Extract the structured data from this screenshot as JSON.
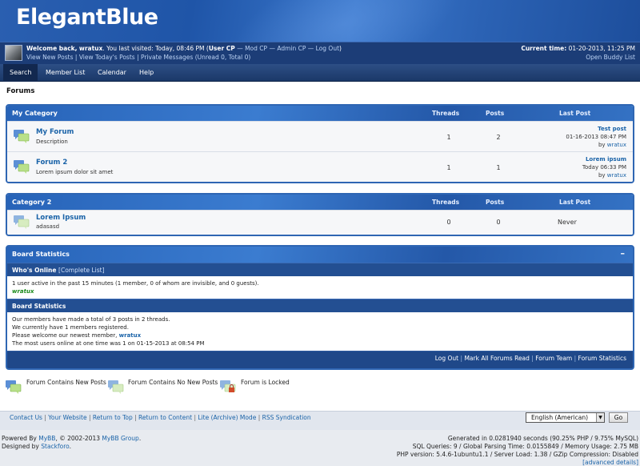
{
  "header": {
    "logo": "ElegantBlue"
  },
  "panel": {
    "welcome_prefix": "Welcome back,",
    "username": "wratux",
    "last_visit": ". You last visited: Today, 08:46 PM (",
    "user_cp": "User CP",
    "mod_cp": "Mod CP",
    "admin_cp": "Admin CP",
    "logout": "Log Out",
    "close": ")",
    "dash": "—",
    "view_new_posts": "View New Posts",
    "view_todays_posts": "View Today's Posts",
    "private_messages": "Private Messages",
    "pm_count": "(Unread 0, Total 0)",
    "current_time_label": "Current time:",
    "current_time": "01-20-2013, 11:25 PM",
    "open_buddy_list": "Open Buddy List",
    "sep": "|"
  },
  "nav": {
    "tabs": [
      "Search",
      "Member List",
      "Calendar",
      "Help"
    ]
  },
  "breadcrumb": "Forums",
  "columns": {
    "threads": "Threads",
    "posts": "Posts",
    "last_post": "Last Post"
  },
  "categories": [
    {
      "name": "My Category",
      "forums": [
        {
          "name": "My Forum",
          "description": "Description",
          "threads": "1",
          "posts": "2",
          "last_post": {
            "title": "Test post",
            "date": "01-16-2013 08:47 PM",
            "by": "by",
            "author": "wratux"
          }
        },
        {
          "name": "Forum 2",
          "description": "Lorem ipsum dolor sit amet",
          "threads": "1",
          "posts": "1",
          "last_post": {
            "title": "Lorem ipsum",
            "date": "Today 06:33 PM",
            "by": "by",
            "author": "wratux"
          }
        }
      ]
    },
    {
      "name": "Category 2",
      "forums": [
        {
          "name": "Lorem Ipsum",
          "description": "adasasd",
          "threads": "0",
          "posts": "0",
          "last_post": {
            "never": "Never"
          }
        }
      ]
    }
  ],
  "board_stats": {
    "title": "Board Statistics",
    "collapse": "–",
    "whos_online": "Who's Online",
    "complete_list": "[Complete List]",
    "online_text": "1 user active in the past 15 minutes (1 member, 0 of whom are invisible, and 0 guests).",
    "online_user": "wratux",
    "stats_title": "Board Statistics",
    "stats_line1": "Our members have made a total of 3 posts in 2 threads.",
    "stats_line2": "We currently have 1 members registered.",
    "stats_line3_prefix": "Please welcome our newest member,",
    "newest_member": "wratux",
    "stats_line4": "The most users online at one time was 1 on 01-15-2013 at 08:54 PM",
    "footer_links": [
      "Log Out",
      "Mark All Forums Read",
      "Forum Team",
      "Forum Statistics"
    ]
  },
  "legend": {
    "new_posts": "Forum Contains New Posts",
    "no_new_posts": "Forum Contains No New Posts",
    "locked": "Forum is Locked"
  },
  "footer": {
    "links": [
      "Contact Us",
      "Your Website",
      "Return to Top",
      "Return to Content",
      "Lite (Archive) Mode",
      "RSS Syndication"
    ],
    "language": "English (American)",
    "go": "Go"
  },
  "copyright": {
    "powered_by": "Powered By",
    "mybb": "MyBB",
    "years": ", © 2002-2013",
    "mybb_group": "MyBB Group",
    "designed_by": "Designed by",
    "stackforo": "Stackforo",
    "generated": "Generated in 0.0281940 seconds (90.25% PHP / 9.75% MySQL)",
    "queries": "SQL Queries: 9 / Global Parsing Time: 0.0155849 / Memory Usage: 2.75 MB",
    "php": "PHP version: 5.4.6-1ubuntu1.1 / Server Load: 1.38 / GZip Compression: Disabled",
    "advanced": "[advanced details]"
  },
  "colors": {
    "accent": "#2f66b3",
    "header": "#2a5fb0",
    "panel": "#1c3d77",
    "link": "#1a63a8",
    "online_user": "#1a8a1a"
  }
}
